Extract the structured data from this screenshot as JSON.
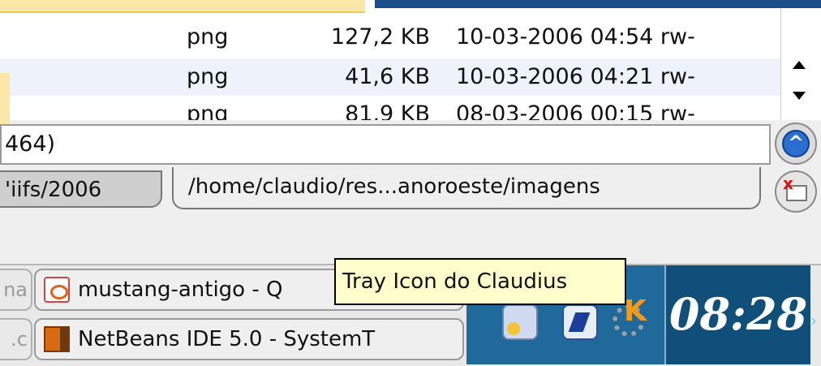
{
  "file_list": {
    "rows": [
      {
        "type": "png",
        "size": "",
        "date": "",
        "perm": ""
      },
      {
        "type": "png",
        "size": "127,2 KB",
        "date": "10-03-2006 04:54",
        "perm": "rw-"
      },
      {
        "type": "png",
        "size": "41,6 KB",
        "date": "10-03-2006 04:21",
        "perm": "rw-"
      },
      {
        "type": "png",
        "size": "81,9 KB",
        "date": "08-03-2006 00:15",
        "perm": "rw-"
      }
    ]
  },
  "command_line": {
    "value": "464)"
  },
  "path_tabs": [
    {
      "label": "'iifs/2006"
    },
    {
      "label": "/home/claudio/res...anoroeste/imagens"
    }
  ],
  "taskbar": {
    "tasks": [
      {
        "ghost": "na",
        "label": "mustang-antigo - Q",
        "icon": "image-viewer-icon"
      },
      {
        "ghost": ".c",
        "label": "NetBeans IDE 5.0 - SystemT",
        "icon": "netbeans-icon"
      }
    ]
  },
  "tray": {
    "icons": [
      "network-icon",
      "notification-icon",
      "kde-gear-icon"
    ],
    "tooltip": "Tray Icon do Claudius"
  },
  "clock": {
    "time": "08:28"
  },
  "colors": {
    "selection_yellow": "#fbe7a8",
    "panel_blue": "#1f6a9a",
    "clock_blue": "#0f4f7a",
    "tooltip_bg": "#ffffcc"
  }
}
